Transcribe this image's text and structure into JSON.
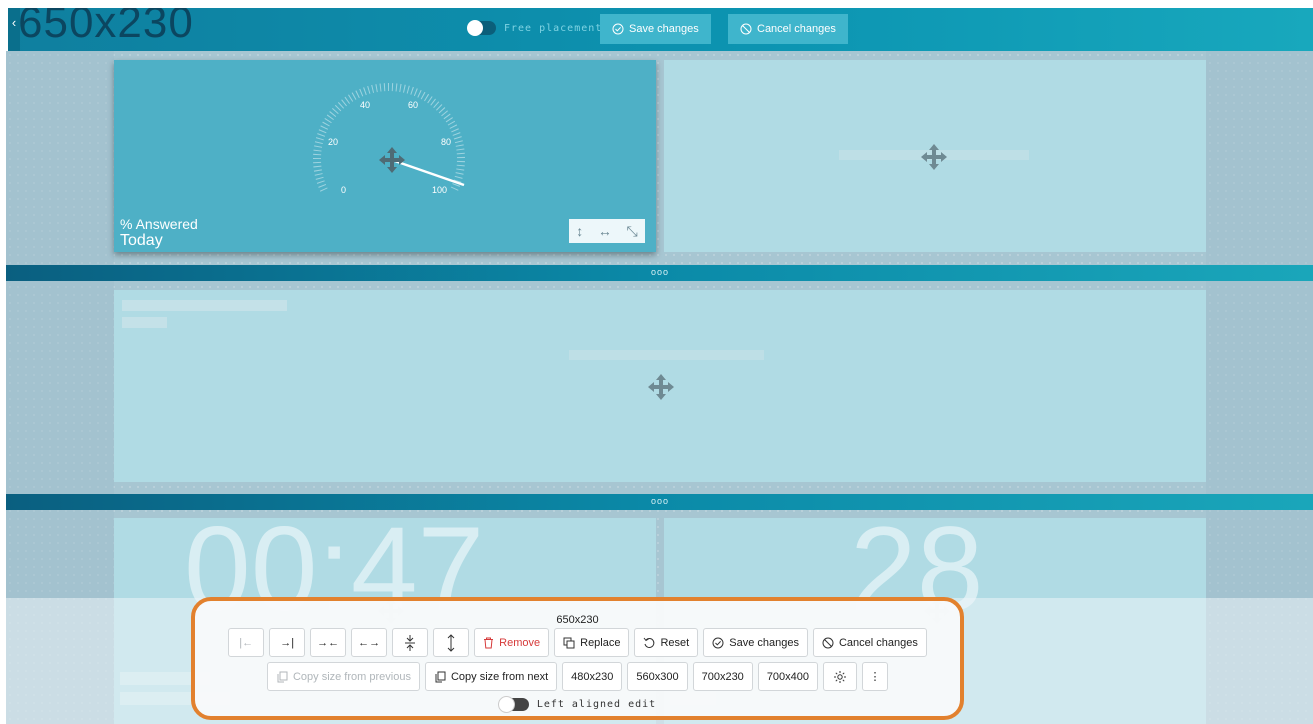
{
  "header": {
    "size_label": "650x230",
    "free_placement_label": "Free placement",
    "save_label": "Save changes",
    "cancel_label": "Cancel changes"
  },
  "widgets": {
    "gauge": {
      "title": "% Answered",
      "subtitle": "Today",
      "ticks": [
        "0",
        "20",
        "40",
        "60",
        "80",
        "100"
      ],
      "value": 100
    },
    "clock": {
      "value": "00:47"
    },
    "count": {
      "value": "28"
    }
  },
  "panel": {
    "size_label": "650x230",
    "remove_label": "Remove",
    "replace_label": "Replace",
    "reset_label": "Reset",
    "save_label": "Save changes",
    "cancel_label": "Cancel changes",
    "copy_prev_label": "Copy size from previous",
    "copy_next_label": "Copy size from next",
    "presets": [
      "480x230",
      "560x300",
      "700x230",
      "700x400"
    ],
    "left_aligned_label": "Left aligned edit"
  },
  "colors": {
    "topbar": "#0c95b2",
    "panel_border": "#e2812e",
    "danger": "#d63a3a"
  }
}
